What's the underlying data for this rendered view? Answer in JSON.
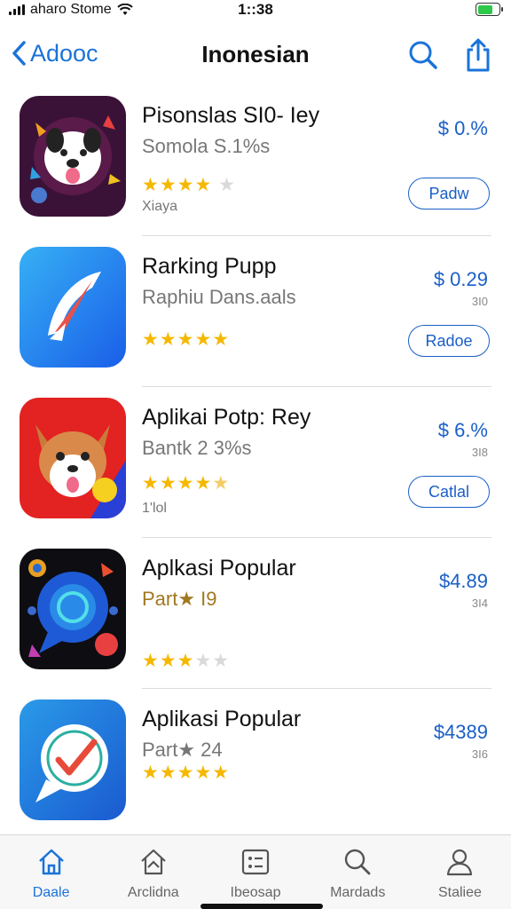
{
  "status_bar": {
    "carrier": "aharo Stome",
    "time": "1::38",
    "battery_color": "#2ec84a"
  },
  "nav": {
    "back_label": "Adooc",
    "title": "Inonesian",
    "search_icon": "search-icon",
    "share_icon": "share-icon"
  },
  "apps": [
    {
      "name": "Pisonslas SI0- Iey",
      "subtitle": "Somola S.1%s",
      "price": "$ 0.%",
      "count": "",
      "rating": 4,
      "stars_on": "★★★★",
      "stars_off": "★",
      "note": "Xiaya",
      "action": "Padw",
      "icon": "dog-mascot-icon"
    },
    {
      "name": "Rarking Pupp",
      "subtitle": "Raphiu Dans.aals",
      "price": "$ 0.29",
      "count": "3I0",
      "rating": 5,
      "stars_on": "★★★★★",
      "stars_off": "",
      "note": "",
      "action": "Radoe",
      "icon": "arrow-feather-icon"
    },
    {
      "name": "Aplikai Potp: Rey",
      "subtitle": "Bantk 2 3%s",
      "price": "$ 6.%",
      "count": "3I8",
      "rating": 4.5,
      "stars_on": "★★★★",
      "stars_off": "★",
      "note": "1'lol",
      "action": "Catlal",
      "icon": "fox-mascot-icon"
    },
    {
      "name": "Aplkasi Popular",
      "subtitle": "Part★ I9",
      "price": "$4.89",
      "count": "3I4",
      "rating": 3,
      "stars_on": "★★★",
      "stars_off": "★★",
      "note": "",
      "action": "",
      "icon": "chat-bubble-icon"
    },
    {
      "name": "Aplikasi Popular",
      "subtitle": "Part★ 24",
      "price": "$4389",
      "count": "3I6",
      "rating": 5,
      "stars_on": "★★★★★",
      "stars_off": "",
      "note": "",
      "action": "",
      "icon": "check-bubble-icon"
    }
  ],
  "tabs": [
    {
      "label": "Daale",
      "icon": "home-icon",
      "active": true
    },
    {
      "label": "Arclidna",
      "icon": "house-outline-icon",
      "active": false
    },
    {
      "label": "Ibeosap",
      "icon": "card-icon",
      "active": false
    },
    {
      "label": "Mardads",
      "icon": "search-icon",
      "active": false
    },
    {
      "label": "Staliee",
      "icon": "person-icon",
      "active": false
    }
  ],
  "colors": {
    "accent": "#1a73d9",
    "price": "#1a5fc7",
    "star": "#f5b800"
  }
}
